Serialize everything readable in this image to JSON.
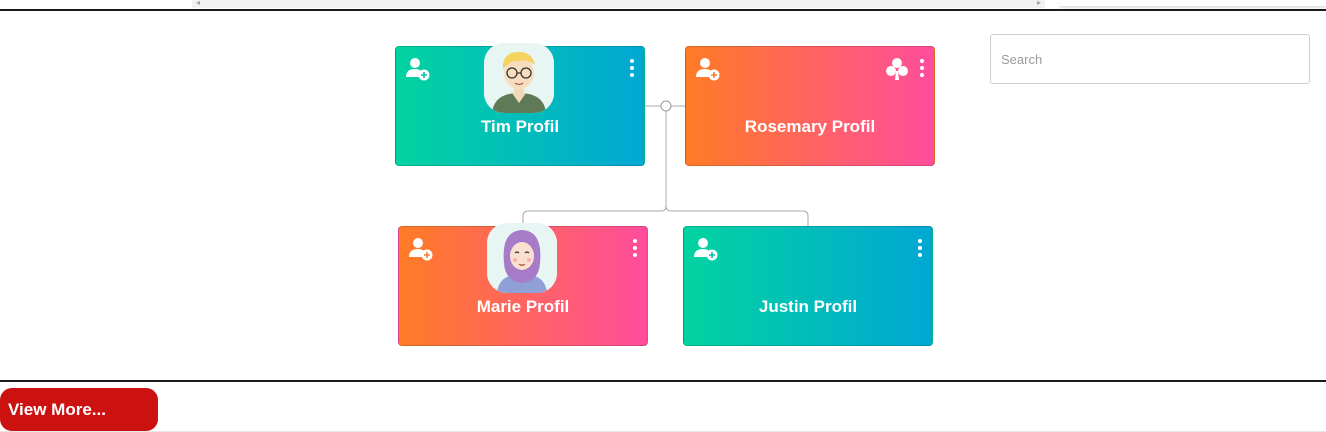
{
  "search": {
    "placeholder": "Search",
    "value": ""
  },
  "nodes": [
    {
      "name": "Tim Profil",
      "avatar": "boy-with-glasses-avatar",
      "style": "teal-gradient"
    },
    {
      "name": "Rosemary Profil",
      "avatar": null,
      "style": "orange-pink-gradient",
      "extra_icon": "club-icon"
    },
    {
      "name": "Marie Profil",
      "avatar": "girl-in-hijab-avatar",
      "style": "orange-pink-gradient"
    },
    {
      "name": "Justin Profil",
      "avatar": null,
      "style": "teal-gradient"
    }
  ],
  "actions": {
    "view_more_label": "View More..."
  },
  "icons": {
    "add_person": "add-person-icon",
    "menu": "kebab-menu-icon",
    "club": "club-icon"
  },
  "colors": {
    "teal_start": "#02d3a0",
    "teal_end": "#01a7d3",
    "orange_start": "#ff7b25",
    "pink_end": "#ff4d9d",
    "view_more_bg": "#cc1111"
  }
}
